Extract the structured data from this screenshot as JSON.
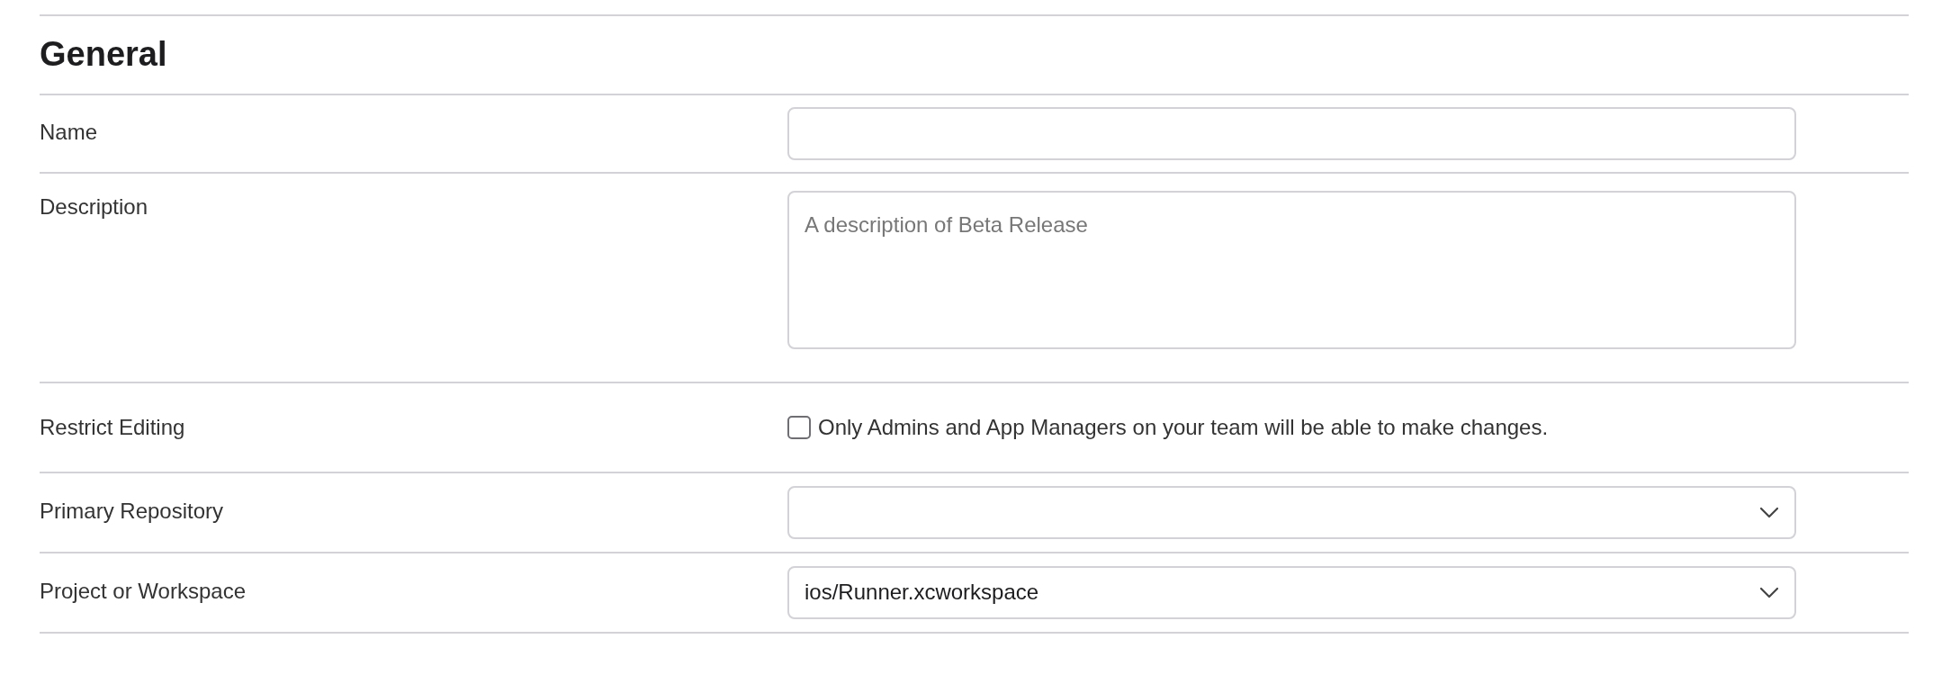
{
  "section_title": "General",
  "fields": [
    {
      "kind": "text",
      "label": "Name"
    },
    {
      "kind": "textarea",
      "label": "Description",
      "placeholder": "A description of Beta Release"
    },
    {
      "kind": "checkbox",
      "label": "Restrict Editing",
      "checked": false,
      "text": "Only Admins and App Managers on your team will be able to make changes."
    },
    {
      "kind": "select",
      "label": "Primary Repository"
    },
    {
      "kind": "select",
      "label": "Project or Workspace",
      "value": "ios/Runner.xcworkspace"
    }
  ]
}
